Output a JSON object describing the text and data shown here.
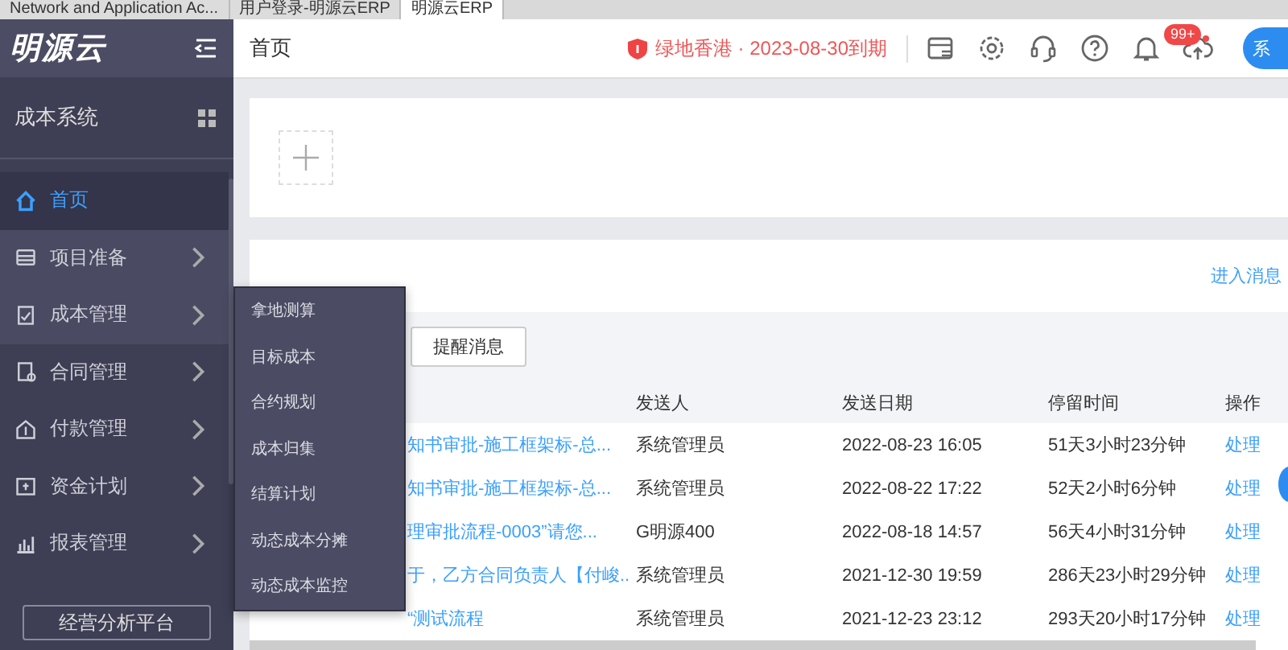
{
  "browser_tabs": [
    {
      "title": "Network and Application Ac...",
      "selected": false
    },
    {
      "title": "用户登录-明源云ERP",
      "selected": false
    },
    {
      "title": "明源云ERP",
      "selected": true
    }
  ],
  "sidebar": {
    "logo": "明源云",
    "system": "成本系统",
    "items": [
      {
        "label": "首页",
        "selected": true,
        "highlighted": false,
        "has_arrow": false
      },
      {
        "label": "项目准备",
        "selected": false,
        "highlighted": true,
        "has_arrow": true
      },
      {
        "label": "成本管理",
        "selected": false,
        "highlighted": true,
        "has_arrow": true,
        "submenu": [
          "拿地测算",
          "目标成本",
          "合约规划",
          "成本归集",
          "结算计划",
          "动态成本分摊",
          "动态成本监控"
        ]
      },
      {
        "label": "合同管理",
        "selected": false,
        "highlighted": false,
        "has_arrow": true
      },
      {
        "label": "付款管理",
        "selected": false,
        "highlighted": false,
        "has_arrow": true
      },
      {
        "label": "资金计划",
        "selected": false,
        "highlighted": false,
        "has_arrow": true
      },
      {
        "label": "报表管理",
        "selected": false,
        "highlighted": false,
        "has_arrow": true
      }
    ],
    "bottom_button": "经营分析平台"
  },
  "header": {
    "title": "首页",
    "license": "绿地香港 · 2023-08-30到期",
    "badge": "99+",
    "avatar": "系"
  },
  "messages": {
    "link": "进入消息",
    "tabs": [
      {
        "label": "提醒消息",
        "selected": false
      }
    ],
    "columns": [
      "发送人",
      "发送日期",
      "停留时间",
      "操作"
    ],
    "rows": [
      {
        "subject": "知书审批-施工框架标-总...",
        "sender": "系统管理员",
        "date": "2022-08-23 16:05",
        "stay": "51天3小时23分钟",
        "action": "处理"
      },
      {
        "subject": "知书审批-施工框架标-总...",
        "sender": "系统管理员",
        "date": "2022-08-22 17:22",
        "stay": "52天2小时6分钟",
        "action": "处理"
      },
      {
        "subject": "理审批流程-0003”请您...",
        "sender": "G明源400",
        "date": "2022-08-18 14:57",
        "stay": "56天4小时31分钟",
        "action": "处理"
      },
      {
        "subject": "于，乙方合同负责人【付峻...",
        "sender": "系统管理员",
        "date": "2021-12-30 19:59",
        "stay": "286天23小时29分钟",
        "action": "处理"
      },
      {
        "subject": "“测试流程",
        "sender": "系统管理员",
        "date": "2021-12-23 23:12",
        "stay": "293天20小时17分钟",
        "action": "处理"
      }
    ]
  }
}
